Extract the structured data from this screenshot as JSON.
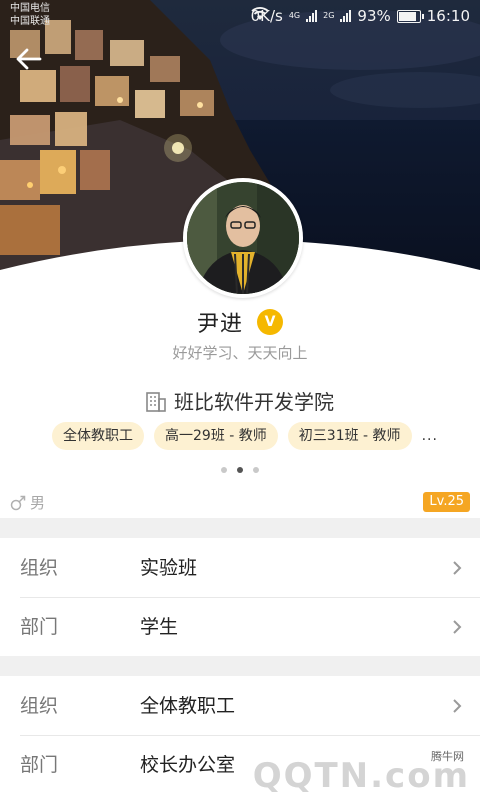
{
  "status_bar": {
    "carrier_1": "中国电信",
    "carrier_2": "中国联通",
    "speed": "0K/s",
    "network_1": "4G",
    "network_2": "2G",
    "battery": "93%",
    "battery_level": 0.93,
    "time": "16:10"
  },
  "header": {
    "back_icon": "arrow-left-icon"
  },
  "profile": {
    "name": "尹进",
    "verified_label": "V",
    "motto": "好好学习、天天向上",
    "school_icon": "building-icon",
    "school": "班比软件开发学院",
    "tags": [
      "全体教职工",
      "高一29班 - 教师",
      "初三31班 - 教师"
    ],
    "tags_more": "...",
    "page_count": 3,
    "active_page": 2,
    "gender_icon": "male-icon",
    "gender": "男",
    "level": "Lv.25"
  },
  "groups": [
    {
      "rows": [
        {
          "key": "组织",
          "value": "实验班"
        },
        {
          "key": "部门",
          "value": "学生"
        }
      ]
    },
    {
      "rows": [
        {
          "key": "组织",
          "value": "全体教职工"
        },
        {
          "key": "部门",
          "value": "校长办公室"
        }
      ]
    }
  ],
  "watermark": {
    "site": "腾牛网",
    "logo": "QQTN.com"
  },
  "colors": {
    "accent": "#f5b800",
    "level_badge": "#f5a623",
    "tag_bg": "#fdf1d2"
  }
}
